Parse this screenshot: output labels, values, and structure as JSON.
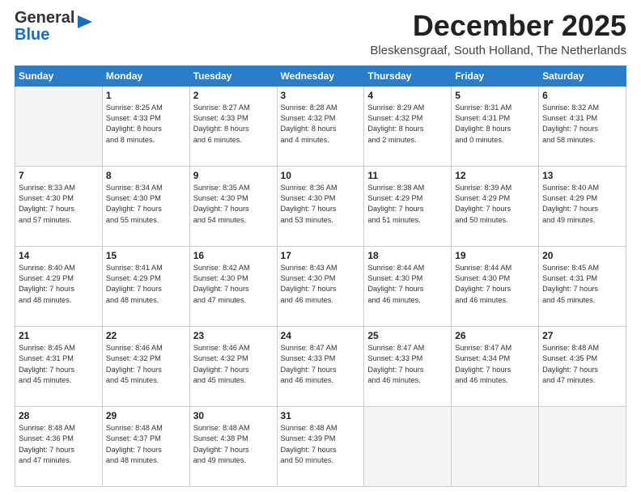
{
  "logo": {
    "general": "General",
    "blue": "Blue"
  },
  "title": "December 2025",
  "subtitle": "Bleskensgraaf, South Holland, The Netherlands",
  "weekdays": [
    "Sunday",
    "Monday",
    "Tuesday",
    "Wednesday",
    "Thursday",
    "Friday",
    "Saturday"
  ],
  "weeks": [
    [
      {
        "day": "",
        "info": ""
      },
      {
        "day": "1",
        "info": "Sunrise: 8:25 AM\nSunset: 4:33 PM\nDaylight: 8 hours\nand 8 minutes."
      },
      {
        "day": "2",
        "info": "Sunrise: 8:27 AM\nSunset: 4:33 PM\nDaylight: 8 hours\nand 6 minutes."
      },
      {
        "day": "3",
        "info": "Sunrise: 8:28 AM\nSunset: 4:32 PM\nDaylight: 8 hours\nand 4 minutes."
      },
      {
        "day": "4",
        "info": "Sunrise: 8:29 AM\nSunset: 4:32 PM\nDaylight: 8 hours\nand 2 minutes."
      },
      {
        "day": "5",
        "info": "Sunrise: 8:31 AM\nSunset: 4:31 PM\nDaylight: 8 hours\nand 0 minutes."
      },
      {
        "day": "6",
        "info": "Sunrise: 8:32 AM\nSunset: 4:31 PM\nDaylight: 7 hours\nand 58 minutes."
      }
    ],
    [
      {
        "day": "7",
        "info": "Sunrise: 8:33 AM\nSunset: 4:30 PM\nDaylight: 7 hours\nand 57 minutes."
      },
      {
        "day": "8",
        "info": "Sunrise: 8:34 AM\nSunset: 4:30 PM\nDaylight: 7 hours\nand 55 minutes."
      },
      {
        "day": "9",
        "info": "Sunrise: 8:35 AM\nSunset: 4:30 PM\nDaylight: 7 hours\nand 54 minutes."
      },
      {
        "day": "10",
        "info": "Sunrise: 8:36 AM\nSunset: 4:30 PM\nDaylight: 7 hours\nand 53 minutes."
      },
      {
        "day": "11",
        "info": "Sunrise: 8:38 AM\nSunset: 4:29 PM\nDaylight: 7 hours\nand 51 minutes."
      },
      {
        "day": "12",
        "info": "Sunrise: 8:39 AM\nSunset: 4:29 PM\nDaylight: 7 hours\nand 50 minutes."
      },
      {
        "day": "13",
        "info": "Sunrise: 8:40 AM\nSunset: 4:29 PM\nDaylight: 7 hours\nand 49 minutes."
      }
    ],
    [
      {
        "day": "14",
        "info": "Sunrise: 8:40 AM\nSunset: 4:29 PM\nDaylight: 7 hours\nand 48 minutes."
      },
      {
        "day": "15",
        "info": "Sunrise: 8:41 AM\nSunset: 4:29 PM\nDaylight: 7 hours\nand 48 minutes."
      },
      {
        "day": "16",
        "info": "Sunrise: 8:42 AM\nSunset: 4:30 PM\nDaylight: 7 hours\nand 47 minutes."
      },
      {
        "day": "17",
        "info": "Sunrise: 8:43 AM\nSunset: 4:30 PM\nDaylight: 7 hours\nand 46 minutes."
      },
      {
        "day": "18",
        "info": "Sunrise: 8:44 AM\nSunset: 4:30 PM\nDaylight: 7 hours\nand 46 minutes."
      },
      {
        "day": "19",
        "info": "Sunrise: 8:44 AM\nSunset: 4:30 PM\nDaylight: 7 hours\nand 46 minutes."
      },
      {
        "day": "20",
        "info": "Sunrise: 8:45 AM\nSunset: 4:31 PM\nDaylight: 7 hours\nand 45 minutes."
      }
    ],
    [
      {
        "day": "21",
        "info": "Sunrise: 8:45 AM\nSunset: 4:31 PM\nDaylight: 7 hours\nand 45 minutes."
      },
      {
        "day": "22",
        "info": "Sunrise: 8:46 AM\nSunset: 4:32 PM\nDaylight: 7 hours\nand 45 minutes."
      },
      {
        "day": "23",
        "info": "Sunrise: 8:46 AM\nSunset: 4:32 PM\nDaylight: 7 hours\nand 45 minutes."
      },
      {
        "day": "24",
        "info": "Sunrise: 8:47 AM\nSunset: 4:33 PM\nDaylight: 7 hours\nand 46 minutes."
      },
      {
        "day": "25",
        "info": "Sunrise: 8:47 AM\nSunset: 4:33 PM\nDaylight: 7 hours\nand 46 minutes."
      },
      {
        "day": "26",
        "info": "Sunrise: 8:47 AM\nSunset: 4:34 PM\nDaylight: 7 hours\nand 46 minutes."
      },
      {
        "day": "27",
        "info": "Sunrise: 8:48 AM\nSunset: 4:35 PM\nDaylight: 7 hours\nand 47 minutes."
      }
    ],
    [
      {
        "day": "28",
        "info": "Sunrise: 8:48 AM\nSunset: 4:36 PM\nDaylight: 7 hours\nand 47 minutes."
      },
      {
        "day": "29",
        "info": "Sunrise: 8:48 AM\nSunset: 4:37 PM\nDaylight: 7 hours\nand 48 minutes."
      },
      {
        "day": "30",
        "info": "Sunrise: 8:48 AM\nSunset: 4:38 PM\nDaylight: 7 hours\nand 49 minutes."
      },
      {
        "day": "31",
        "info": "Sunrise: 8:48 AM\nSunset: 4:39 PM\nDaylight: 7 hours\nand 50 minutes."
      },
      {
        "day": "",
        "info": ""
      },
      {
        "day": "",
        "info": ""
      },
      {
        "day": "",
        "info": ""
      }
    ]
  ]
}
